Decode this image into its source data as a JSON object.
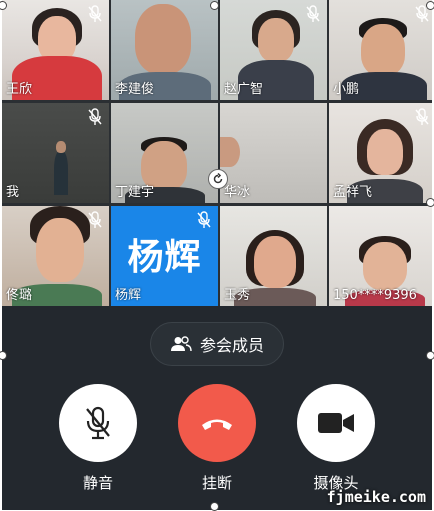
{
  "participants": [
    {
      "name": "王欣",
      "muted": true
    },
    {
      "name": "李建俊",
      "muted": false
    },
    {
      "name": "赵广智",
      "muted": true
    },
    {
      "name": "小鹏",
      "muted": true
    },
    {
      "name": "我",
      "muted": true
    },
    {
      "name": "丁建宇",
      "muted": false
    },
    {
      "name": "华冰",
      "muted": false
    },
    {
      "name": "孟祥飞",
      "muted": true
    },
    {
      "name": "佟璐",
      "muted": true
    },
    {
      "name": "杨辉",
      "muted": true,
      "avatar_text": "杨辉"
    },
    {
      "name": "玉秀",
      "muted": false
    },
    {
      "name": "150****9396",
      "muted": false
    }
  ],
  "controls": {
    "members_label": "参会成员",
    "mute_label": "静音",
    "hangup_label": "挂断",
    "camera_label": "摄像头"
  },
  "watermark": "fjmeike.com",
  "colors": {
    "panel": "#23282e",
    "hangup": "#f25a4b",
    "name_card": "#1a86e8"
  }
}
